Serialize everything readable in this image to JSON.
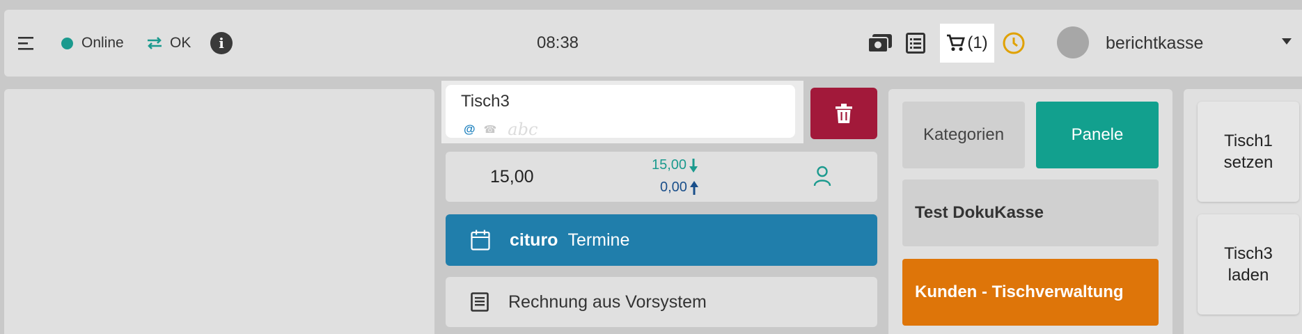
{
  "header": {
    "status_online": "Online",
    "status_sync": "OK",
    "info_label": "i",
    "time": "08:38",
    "cart_count": "(1)",
    "username": "berichtkasse"
  },
  "table": {
    "name": "Tisch3",
    "email_symbol": "@",
    "phone_symbol": "☎",
    "hint": "abc"
  },
  "amounts": {
    "total": "15,00",
    "received": "15,00",
    "change": "0,00"
  },
  "cituro": {
    "brand": "cituro",
    "label": "Termine"
  },
  "invoice": {
    "label": "Rechnung aus Vorsystem"
  },
  "panels": {
    "tab_categories": "Kategorien",
    "tab_panels": "Panele",
    "items": [
      {
        "label": "Test DokuKasse"
      },
      {
        "label": "Kunden - Tischverwaltung"
      }
    ]
  },
  "actions": [
    {
      "label": "Tisch1 setzen"
    },
    {
      "label": "Tisch3 laden"
    }
  ],
  "colors": {
    "online": "#1b9a8e",
    "delete": "#a2193a",
    "cituro": "#207eab",
    "panel_active": "#12a08e",
    "orange": "#de7509",
    "history": "#e0a100"
  },
  "icons": [
    "menu-icon",
    "sync-icon",
    "info-icon",
    "cash-icon",
    "list-icon",
    "cart-icon",
    "history-icon",
    "chevron-down-icon",
    "trash-icon",
    "person-icon",
    "calendar-icon",
    "document-icon"
  ]
}
